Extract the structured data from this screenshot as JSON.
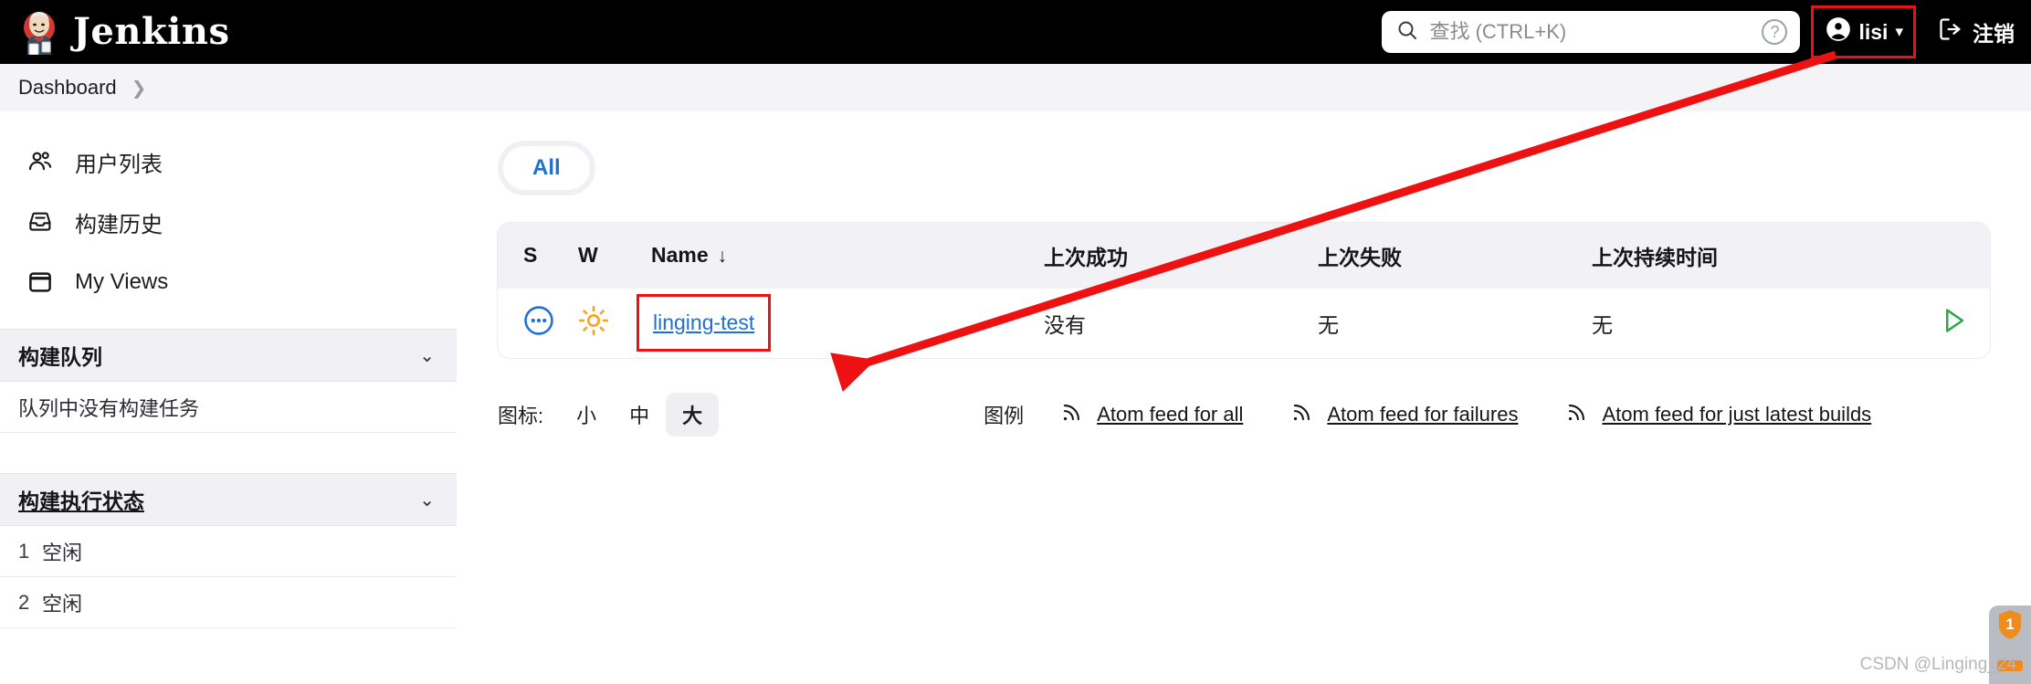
{
  "header": {
    "brand_name": "Jenkins",
    "brand_icon": "jenkins-butler-logo",
    "search": {
      "icon": "search-icon",
      "placeholder": "查找 (CTRL+K)",
      "value": "",
      "help_icon": "help-circle-icon"
    },
    "user": {
      "icon": "user-avatar-icon",
      "name": "lisi",
      "chevron": "▾"
    },
    "logout": {
      "icon": "logout-icon",
      "label": "注销"
    }
  },
  "breadcrumb": {
    "items": [
      {
        "label": "Dashboard"
      }
    ],
    "separator": "❯"
  },
  "sidebar": {
    "nav": [
      {
        "label": "用户列表",
        "icon": "people-icon"
      },
      {
        "label": "构建历史",
        "icon": "inbox-icon"
      },
      {
        "label": "My Views",
        "icon": "window-icon"
      }
    ],
    "build_queue": {
      "title": "构建队列",
      "chevron": "⌄",
      "empty_text": "队列中没有构建任务"
    },
    "build_executor": {
      "title": "构建执行状态",
      "chevron": "⌄",
      "executors": [
        {
          "num": "1",
          "status": "空闲"
        },
        {
          "num": "2",
          "status": "空闲"
        }
      ]
    }
  },
  "main": {
    "tabs": [
      {
        "label": "All",
        "selected": true
      }
    ],
    "table": {
      "headers": {
        "s": "S",
        "w": "W",
        "name": "Name",
        "name_sort": "↓",
        "last_success": "上次成功",
        "last_failure": "上次失败",
        "last_duration": "上次持续时间",
        "actions": ""
      },
      "rows": [
        {
          "status_icon": "status-pending-icon",
          "weather_icon": "weather-sunny-icon",
          "name": "linging-test",
          "last_success": "没有",
          "last_failure": "无",
          "last_duration": "无",
          "action_icon": "build-now-play-icon"
        }
      ]
    },
    "footer": {
      "icon_size_label": "图标:",
      "sizes": [
        {
          "label": "小",
          "selected": false
        },
        {
          "label": "中",
          "selected": false
        },
        {
          "label": "大",
          "selected": true
        }
      ],
      "legend_label": "图例",
      "feeds": [
        {
          "label": "Atom feed for all",
          "icon": "rss-icon"
        },
        {
          "label": "Atom feed for failures",
          "icon": "rss-icon"
        },
        {
          "label": "Atom feed for just latest builds",
          "icon": "rss-icon"
        }
      ]
    }
  },
  "annotations": {
    "color": "#ee1111",
    "arrow_icon": "red-arrow-annotation",
    "boxes": [
      {
        "target": "user-chip"
      },
      {
        "target": "job-name-link"
      }
    ]
  },
  "watermark": {
    "text": "CSDN @Linging_24"
  },
  "corner_badge": {
    "count": "1",
    "icon": "shield-icon"
  },
  "colors": {
    "header_bg": "#000000",
    "accent_link": "#1f6fd4",
    "annotation_red": "#ee1111",
    "weather_orange": "#f5a623",
    "play_green": "#2aa84a"
  }
}
